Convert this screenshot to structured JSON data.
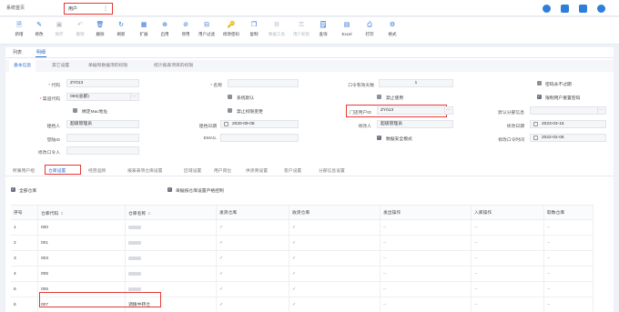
{
  "tabs": {
    "home": "系统首页",
    "active": "用户",
    "active_more": "⋮"
  },
  "toolbar": [
    {
      "label": "新增",
      "icon": "add-icon",
      "glyph": "🗎",
      "disabled": false
    },
    {
      "label": "修改",
      "icon": "edit-icon",
      "glyph": "✎",
      "disabled": false
    },
    {
      "label": "保存",
      "icon": "save-icon",
      "glyph": "▣",
      "disabled": true
    },
    {
      "label": "撤销",
      "icon": "undo-icon",
      "glyph": "↶",
      "disabled": true
    },
    {
      "label": "删除",
      "icon": "delete-icon",
      "glyph": "🗑",
      "disabled": false
    },
    {
      "label": "刷新",
      "icon": "refresh-icon",
      "glyph": "↻",
      "disabled": false
    },
    {
      "label": "扩展",
      "icon": "extend-icon",
      "glyph": "▦",
      "disabled": false
    },
    {
      "label": "启用",
      "icon": "enable-icon",
      "glyph": "⊕",
      "disabled": false
    },
    {
      "label": "停用",
      "icon": "disable-icon",
      "glyph": "⊘",
      "disabled": false
    },
    {
      "label": "用户过滤",
      "icon": "filter-icon",
      "glyph": "⊟",
      "disabled": false
    },
    {
      "label": "修改密码",
      "icon": "password-icon",
      "glyph": "🔑",
      "disabled": false
    },
    {
      "label": "复制",
      "icon": "copy-icon",
      "glyph": "❐",
      "disabled": false
    },
    {
      "label": "数据工具",
      "icon": "data-tool-icon",
      "glyph": "⚙",
      "disabled": true
    },
    {
      "label": "用户权限",
      "icon": "permission-icon",
      "glyph": "⚿",
      "disabled": true
    },
    {
      "label": "查询",
      "icon": "query-icon",
      "glyph": "🗒",
      "disabled": false
    },
    {
      "label": "Excel",
      "icon": "excel-icon",
      "glyph": "▤",
      "disabled": false
    },
    {
      "label": "打印",
      "icon": "print-icon",
      "glyph": "⎙",
      "disabled": false
    },
    {
      "label": "格式",
      "icon": "format-icon",
      "glyph": "⚙",
      "disabled": false
    }
  ],
  "view_tabs": [
    "列表",
    "明细"
  ],
  "group_tabs": [
    "基本信息",
    "其它设置",
    "单据和数据项的权限",
    "统计报表项目的权限"
  ],
  "form": {
    "code_label": "代码",
    "code_value": "ZY013",
    "name_label": "名称",
    "name_value": "",
    "pwd_days_label": "口令有效天数",
    "pwd_days_value": "1",
    "pwd_never_expire": "密码永不过期",
    "channel_code_label": "渠道代码",
    "channel_code_value": "000(总部)",
    "sys_default": "系统默认",
    "forbid_use": "禁止使用",
    "limit_reset_pwd": "限制用户重置密码",
    "bind_mac": "绑定Mac地址",
    "stop_perm_change": "禁止权限变更",
    "store_user_id_label": "门店用户ID",
    "store_user_id_value": "ZY013",
    "default_dept_label": "默认分部信息",
    "default_dept_value": "",
    "creator_label": "建档人",
    "creator_value": "超级管理员",
    "create_date_label": "建档日期",
    "create_date_value": "2020-09-08",
    "modifier_label": "修改人",
    "modifier_value": "超级管理员",
    "modify_date_label": "修改日期",
    "modify_date_value": "2023-03-15",
    "login_id_label": "登陆ID",
    "login_id_value": "",
    "email_label": "EMAIL",
    "email_value": "",
    "data_security": "数据安全模式",
    "pwd_modify_time_label": "修改口令时间",
    "pwd_modify_time_value": "2022-02-06",
    "pwd_modifier_label": "修改口令人",
    "pwd_modifier_value": ""
  },
  "setting_tabs": [
    "所属用户组",
    "仓库设置",
    "经营品牌",
    "报表表项仓库设置",
    "区域设置",
    "用户岗位",
    "供货商设置",
    "客户设置",
    "分部信息设置"
  ],
  "options": {
    "all_warehouses": "全部仓库",
    "single_doc_control": "单据按仓库设置严格控制"
  },
  "grid": {
    "columns": [
      "序号",
      "仓库代码",
      "仓库名称",
      "发货仓库",
      "收货仓库",
      "发出操作",
      "入库操作",
      "取数仓库"
    ],
    "rows": [
      {
        "seq": "1",
        "code": "000",
        "name": ""
      },
      {
        "seq": "2",
        "code": "001",
        "name": ""
      },
      {
        "seq": "3",
        "code": "003",
        "name": ""
      },
      {
        "seq": "4",
        "code": "005",
        "name": ""
      },
      {
        "seq": "5",
        "code": "006",
        "name": ""
      },
      {
        "seq": "6",
        "code": "007",
        "name": "调拨中转仓"
      }
    ],
    "check_mark": "✓",
    "dash": "--",
    "sort_glyph": "⇕"
  }
}
